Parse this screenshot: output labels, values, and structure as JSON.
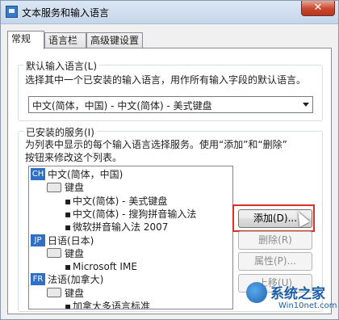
{
  "window": {
    "title": "文本服务和输入语言",
    "close_glyph": "✕"
  },
  "tabs": [
    {
      "label": "常规",
      "active": true
    },
    {
      "label": "语言栏",
      "active": false
    },
    {
      "label": "高级键设置",
      "active": false
    }
  ],
  "default_lang": {
    "group_label": "默认输入语言(L)",
    "description": "选择其中一个已安装的输入语言，用作所有输入字段的默认语言。",
    "selected": "中文(简体，中国) - 中文(简体) - 美式键盘"
  },
  "installed": {
    "group_label": "已安装的服务(I)",
    "description_line1": "为列表中显示的每个输入语言选择服务。使用“添加”和“删除”",
    "description_line2": "按钮来修改这个列表。",
    "tree": [
      {
        "badge": "CH",
        "label": "中文(简体，中国)",
        "level": 0,
        "kind": "lang"
      },
      {
        "label": "键盘",
        "level": 1,
        "kind": "group"
      },
      {
        "label": "中文(简体) - 美式键盘",
        "level": 2,
        "kind": "item"
      },
      {
        "label": "中文(简体) - 搜狗拼音输入法",
        "level": 2,
        "kind": "item"
      },
      {
        "label": "微软拼音输入法 2007",
        "level": 2,
        "kind": "item"
      },
      {
        "badge": "JP",
        "label": "日语(日本)",
        "level": 0,
        "kind": "lang"
      },
      {
        "label": "键盘",
        "level": 1,
        "kind": "group"
      },
      {
        "label": "Microsoft IME",
        "level": 2,
        "kind": "item"
      },
      {
        "badge": "FR",
        "label": "法语(加拿大)",
        "level": 0,
        "kind": "lang"
      },
      {
        "label": "键盘",
        "level": 1,
        "kind": "group"
      },
      {
        "label": "加拿大多语言标准",
        "level": 2,
        "kind": "item"
      }
    ]
  },
  "buttons": {
    "add": "添加(D)...",
    "remove": "删除(R)",
    "properties": "属性(P)...",
    "up": "上移(U)"
  },
  "watermark": {
    "title": "系统之家",
    "subtitle": "Win10net.com"
  }
}
